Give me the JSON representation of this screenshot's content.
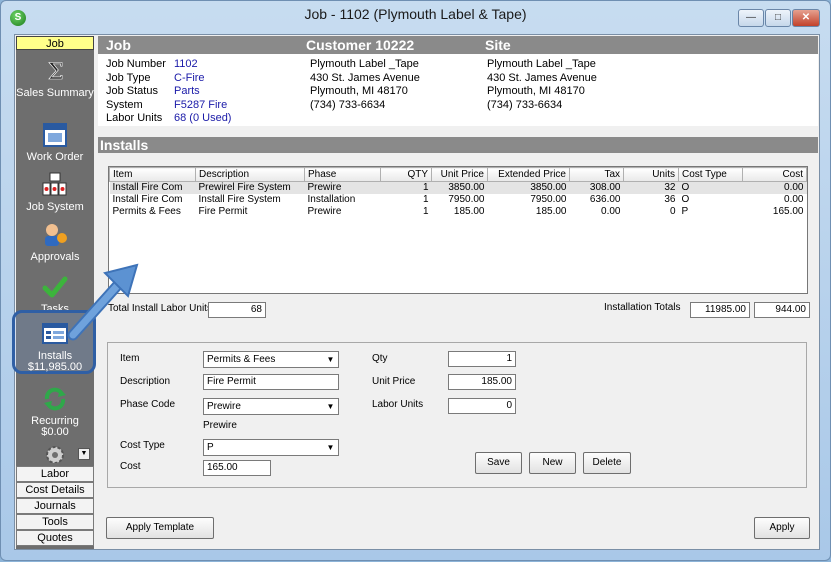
{
  "window": {
    "title": "Job - 1102 (Plymouth Label & Tape)",
    "app_icon": "S",
    "min": "▭",
    "max": "▢",
    "close": "✕"
  },
  "sidebar": {
    "top_label": "Job",
    "items": [
      {
        "label": "Sales Summary",
        "icon": "sigma-icon"
      },
      {
        "label": "Work Order",
        "icon": "work-order-icon"
      },
      {
        "label": "Job System",
        "icon": "job-system-icon"
      },
      {
        "label": "Approvals",
        "icon": "approvals-icon"
      },
      {
        "label": "Tasks",
        "icon": "check-icon"
      },
      {
        "label": "Installs",
        "sub": "$11,985.00",
        "icon": "installs-icon"
      },
      {
        "label": "Recurring",
        "sub": "$0.00",
        "icon": "recurring-icon"
      }
    ],
    "bottom": [
      "Labor",
      "Cost Details",
      "Journals",
      "Tools",
      "Quotes"
    ]
  },
  "header": {
    "job_title": "Job",
    "customer_title": "Customer 10222",
    "site_title": "Site",
    "job_fields": [
      {
        "k": "Job Number",
        "v": "1102"
      },
      {
        "k": "Job Type",
        "v": "C-Fire"
      },
      {
        "k": "Job Status",
        "v": "Parts"
      },
      {
        "k": "System",
        "v": "F5287 Fire"
      },
      {
        "k": "Labor Units",
        "v": "68 (0 Used)"
      }
    ],
    "customer": [
      "Plymouth Label _Tape",
      "430 St. James Avenue",
      "Plymouth, MI  48170",
      "(734) 733-6634"
    ],
    "site": [
      "Plymouth Label _Tape",
      "430 St. James Avenue",
      "Plymouth, MI  48170",
      "(734) 733-6634"
    ]
  },
  "installs": {
    "title": "Installs",
    "columns": [
      "Item",
      "Description",
      "Phase",
      "QTY",
      "Unit Price",
      "Extended Price",
      "Tax",
      "Units",
      "Cost Type",
      "Cost"
    ],
    "rows": [
      [
        "Install Fire Com",
        "Prewirel Fire System",
        "Prewire",
        "1",
        "3850.00",
        "3850.00",
        "308.00",
        "32",
        "O",
        "0.00"
      ],
      [
        "Install Fire Com",
        "Install Fire System",
        "Installation",
        "1",
        "7950.00",
        "7950.00",
        "636.00",
        "36",
        "O",
        "0.00"
      ],
      [
        "Permits & Fees",
        "Fire Permit",
        "Prewire",
        "1",
        "185.00",
        "185.00",
        "0.00",
        "0",
        "P",
        "165.00"
      ]
    ],
    "total_labor_label": "Total Install Labor Units",
    "total_labor_value": "68",
    "installation_totals_label": "Installation Totals",
    "installation_total_price": "11985.00",
    "installation_total_cost": "944.00"
  },
  "edit": {
    "item_label": "Item",
    "item_value": "Permits & Fees",
    "description_label": "Description",
    "description_value": "Fire Permit",
    "phase_label": "Phase Code",
    "phase_value": "Prewire",
    "phase_caption": "Prewire",
    "cost_type_label": "Cost Type",
    "cost_type_value": "P",
    "cost_label": "Cost",
    "cost_value": "165.00",
    "qty_label": "Qty",
    "qty_value": "1",
    "unit_price_label": "Unit Price",
    "unit_price_value": "185.00",
    "labor_units_label": "Labor Units",
    "labor_units_value": "0",
    "save": "Save",
    "new": "New",
    "delete": "Delete"
  },
  "footer": {
    "apply_template": "Apply Template",
    "apply": "Apply"
  },
  "colors": {
    "accent": "#1a1aa8",
    "header_gray": "#8a8a8a",
    "sidebar": "#6e6e6e",
    "highlight": "#2f5fa5"
  }
}
